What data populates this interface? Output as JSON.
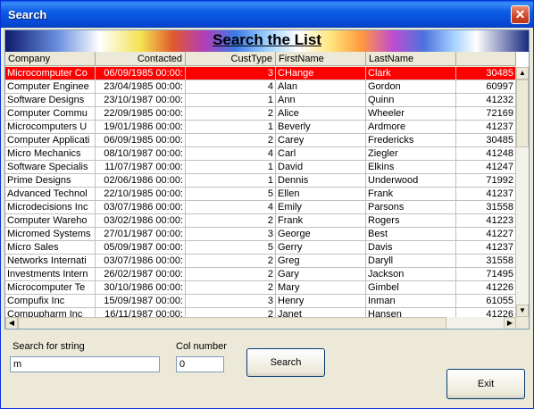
{
  "window": {
    "title": "Search"
  },
  "grid": {
    "banner_title": "Search the List",
    "columns": [
      "Company",
      "Contacted",
      "CustType",
      "FirstName",
      "LastName",
      ""
    ],
    "rows": [
      [
        "Microcomputer Co",
        "06/09/1985 00:00:",
        "3",
        "CHange",
        "Clark",
        "30485"
      ],
      [
        "Computer Enginee",
        "23/04/1985 00:00:",
        "4",
        "Alan",
        "Gordon",
        "60997"
      ],
      [
        "Software Designs",
        "23/10/1987 00:00:",
        "1",
        "Ann",
        "Quinn",
        "41232"
      ],
      [
        "Computer Commu",
        "22/09/1985 00:00:",
        "2",
        "Alice",
        "Wheeler",
        "72169"
      ],
      [
        "Microcomputers U",
        "19/01/1986 00:00:",
        "1",
        "Beverly",
        "Ardmore",
        "41237"
      ],
      [
        "Computer Applicati",
        "06/09/1985 00:00:",
        "2",
        "Carey",
        "Fredericks",
        "30485"
      ],
      [
        "Micro Mechanics",
        "08/10/1987 00:00:",
        "4",
        "Carl",
        "Ziegler",
        "41248"
      ],
      [
        "Software Specialis",
        "11/07/1987 00:00:",
        "1",
        "David",
        "Elkins",
        "41247"
      ],
      [
        "Prime Designs",
        "02/06/1986 00:00:",
        "1",
        "Dennis",
        "Underwood",
        "71992"
      ],
      [
        "Advanced Technol",
        "22/10/1985 00:00:",
        "5",
        "Ellen",
        "Frank",
        "41237"
      ],
      [
        "Microdecisions Inc",
        "03/07/1986 00:00:",
        "4",
        "Emily",
        "Parsons",
        "31558"
      ],
      [
        "Computer Wareho",
        "03/02/1986 00:00:",
        "2",
        "Frank",
        "Rogers",
        "41223"
      ],
      [
        "Micromed Systems",
        "27/01/1987 00:00:",
        "3",
        "George",
        "Best",
        "41227"
      ],
      [
        "Micro Sales",
        "05/09/1987 00:00:",
        "5",
        "Gerry",
        "Davis",
        "41237"
      ],
      [
        "Networks Internati",
        "03/07/1986 00:00:",
        "2",
        "Greg",
        "Daryll",
        "31558"
      ],
      [
        "Investments Intern",
        "26/02/1987 00:00:",
        "2",
        "Gary",
        "Jackson",
        "71495"
      ],
      [
        "Microcomputer Te",
        "30/10/1986 00:00:",
        "2",
        "Mary",
        "Gimbel",
        "41226"
      ],
      [
        "Compufix Inc",
        "15/09/1987 00:00:",
        "3",
        "Henry",
        "Inman",
        "61055"
      ],
      [
        "Compupharm Inc",
        "16/11/1987 00:00:",
        "2",
        "Janet",
        "Hansen",
        "41226"
      ]
    ],
    "selected_row": 0
  },
  "search": {
    "string_label": "Search for string",
    "string_value": "m",
    "col_label": "Col number",
    "col_value": "0",
    "search_button": "Search",
    "exit_button": "Exit"
  },
  "colors": {
    "selection": "#ff0000",
    "titlebar": "#0a5ee8"
  }
}
